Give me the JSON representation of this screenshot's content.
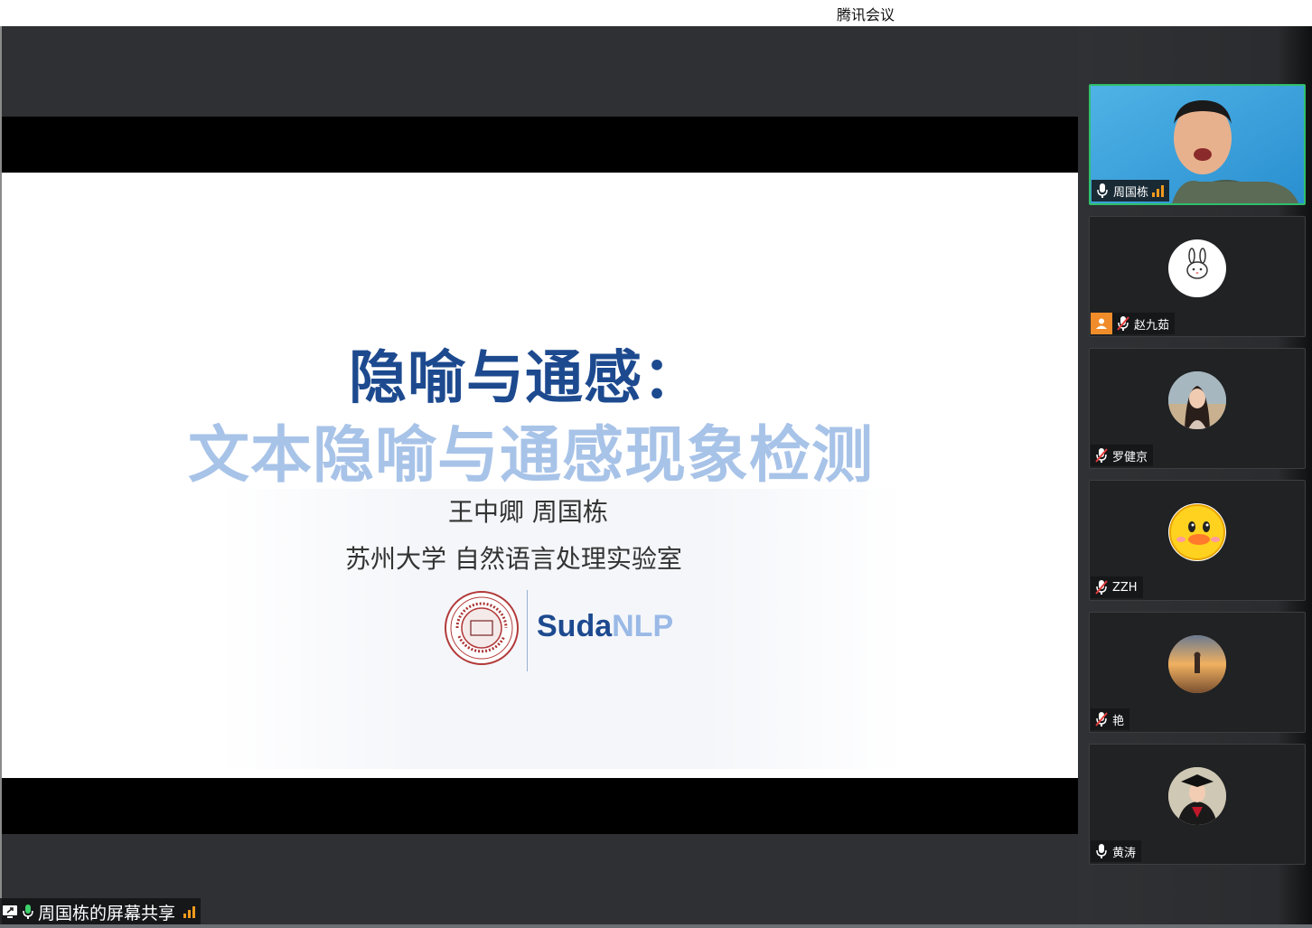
{
  "window": {
    "title": "腾讯会议"
  },
  "slide": {
    "title_line1": "隐喻与通感：",
    "title_line2": "文本隐喻与通感现象检测",
    "authors": "王中卿  周国栋",
    "affiliation": "苏州大学  自然语言处理实验室",
    "brand_part1": "Suda",
    "brand_part2": "NLP",
    "logo_text": "SOOCHOW UNIVERSITY",
    "logo_motto": "UNTO A FULL GROWN MAN"
  },
  "participants": [
    {
      "name": "周国栋",
      "mic": "on",
      "speaking": true,
      "signal": "on",
      "colors": {
        "border": "#2fbf6a"
      }
    },
    {
      "name": "赵九茹",
      "mic": "muted",
      "badge": "person-icon"
    },
    {
      "name": "罗健京",
      "mic": "muted"
    },
    {
      "name": "ZZH",
      "mic": "muted"
    },
    {
      "name": "艳",
      "mic": "muted"
    },
    {
      "name": "黄涛",
      "mic": "on"
    }
  ],
  "share_bar": {
    "label": "周国栋的屏幕共享"
  },
  "colors": {
    "accent_dark": "#1d4a8f",
    "accent_light": "#a8c3e8",
    "active_border": "#2fbf6a",
    "signal": "#f29b1d"
  }
}
